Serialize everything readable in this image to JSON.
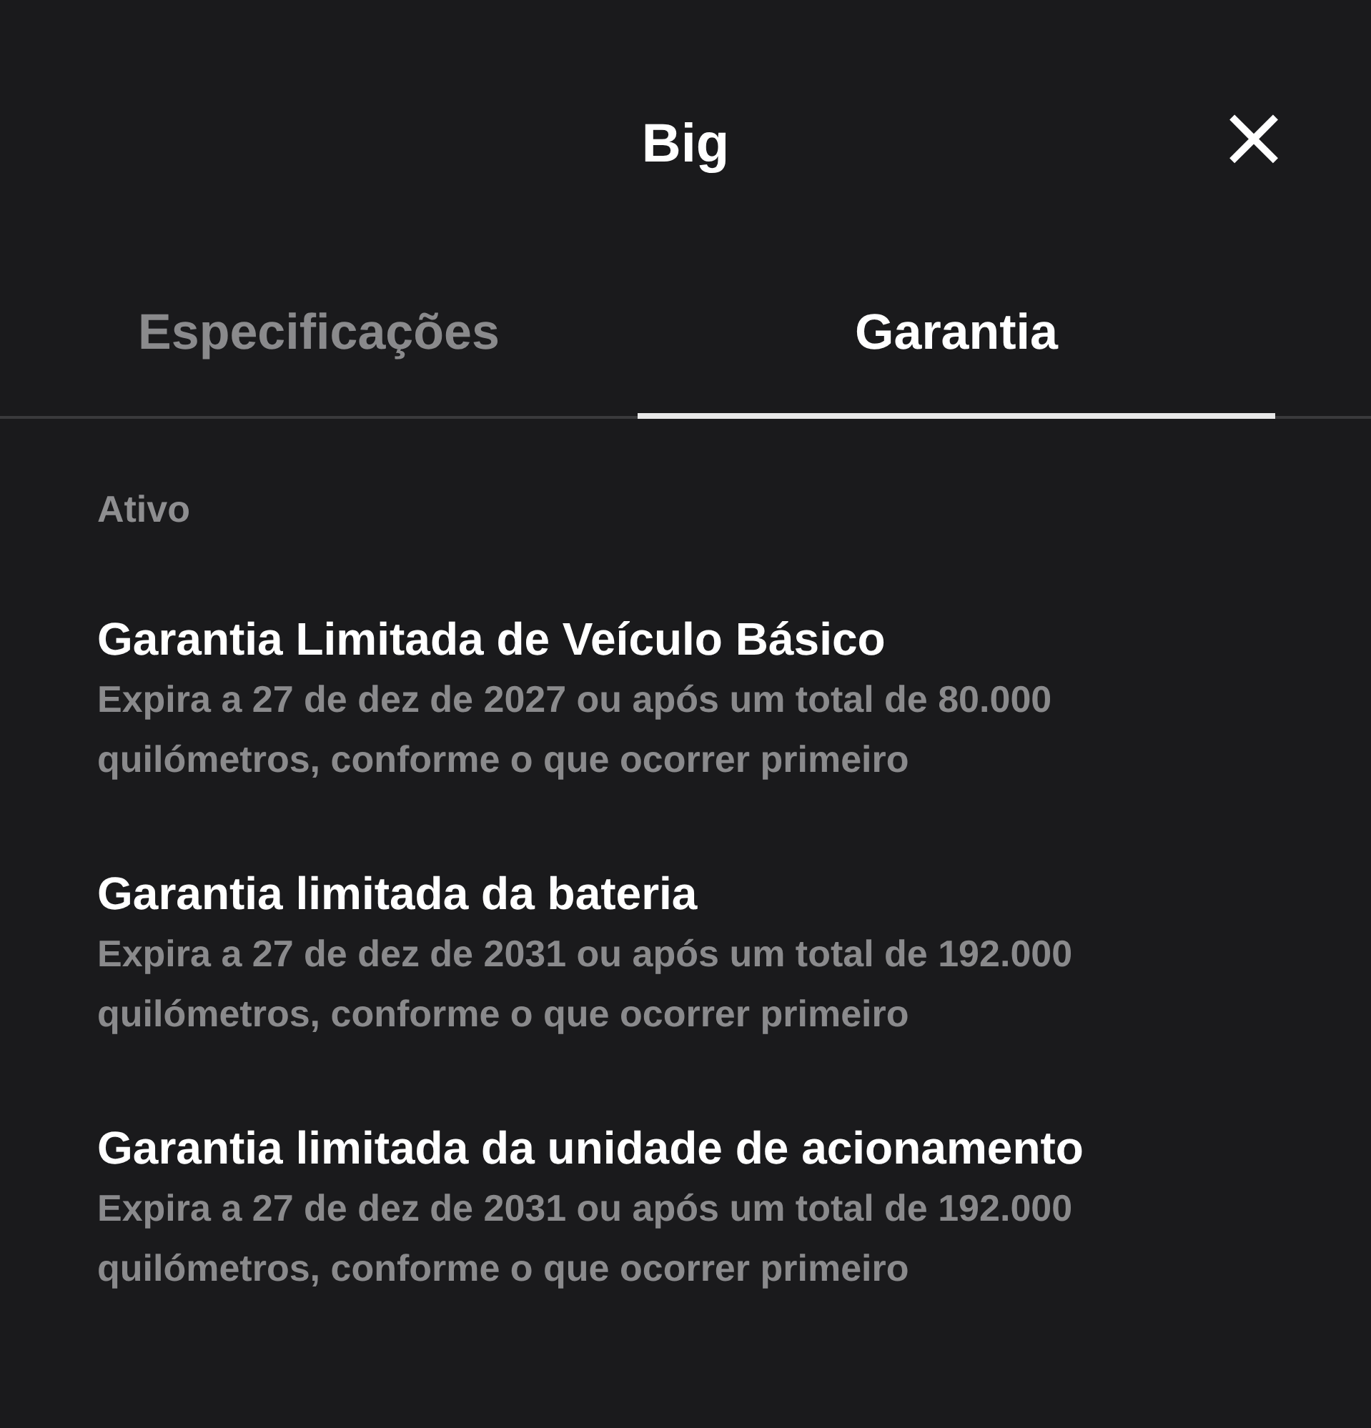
{
  "header": {
    "title": "Big",
    "close": "×"
  },
  "tabs": [
    {
      "label": "Especificações",
      "selected": false
    },
    {
      "label": "Garantia",
      "selected": true
    }
  ],
  "section": "Ativo",
  "warranties": [
    {
      "title": "Garantia Limitada de Veículo Básico",
      "description": "Expira a 27 de dez de 2027 ou após um total de 80.000 quilómetros, conforme o que ocorrer primeiro"
    },
    {
      "title": "Garantia limitada da bateria",
      "description": "Expira a 27 de dez de 2031 ou após um total de 192.000 quilómetros, conforme o que ocorrer primeiro"
    },
    {
      "title": "Garantia limitada da unidade de acionamento",
      "description": "Expira a 27 de dez de 2031 ou após um total de 192.000 quilómetros, conforme o que ocorrer primeiro"
    }
  ]
}
